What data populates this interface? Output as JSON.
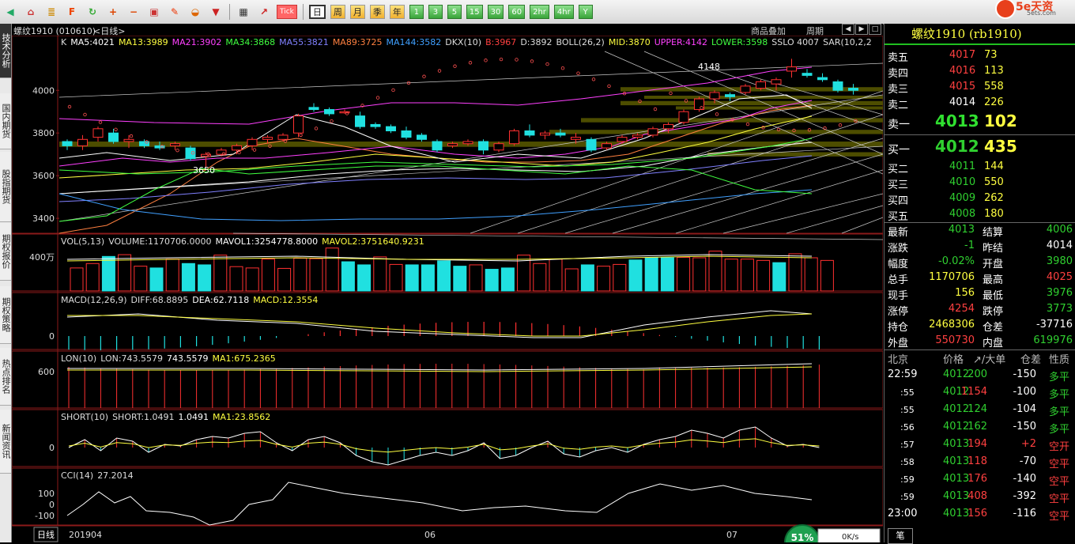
{
  "toolbar": {
    "icons": [
      "back-icon",
      "home-icon",
      "list-icon",
      "f10-icon",
      "refresh-icon",
      "zoom-in-icon",
      "zoom-out-icon",
      "window-icon",
      "pen-icon",
      "chart-icon",
      "filter-icon",
      "table-icon",
      "trend-icon"
    ],
    "tick_label": "Tick",
    "periods": [
      "日",
      "周",
      "月",
      "季",
      "年"
    ],
    "minutes": [
      "1",
      "3",
      "5",
      "15",
      "30",
      "60",
      "2hr",
      "4hr",
      "Y"
    ],
    "active_period": "日"
  },
  "sidebar": {
    "tabs": [
      "技术分析",
      "国内期货",
      "股指期货",
      "期权报价",
      "期权策略",
      "热点排名",
      "新闻资讯"
    ]
  },
  "chart": {
    "header_title": "螺纹1910 (010610)",
    "header_period": "<日线>",
    "top_right": [
      "商品叠加",
      "周期"
    ],
    "k_legend": [
      {
        "text": "K",
        "color": "#dddddd"
      },
      {
        "text": "MA5:4021",
        "color": "#ffffff"
      },
      {
        "text": "MA13:3989",
        "color": "#ffff40"
      },
      {
        "text": "MA21:3902",
        "color": "#ff40ff"
      },
      {
        "text": "MA34:3868",
        "color": "#40ff40"
      },
      {
        "text": "MA55:3821",
        "color": "#8080ff"
      },
      {
        "text": "MA89:3725",
        "color": "#ff8040"
      },
      {
        "text": "MA144:3582",
        "color": "#40a0ff"
      },
      {
        "text": "DKX(10)",
        "color": "#dddddd"
      },
      {
        "text": "B:3967",
        "color": "#ff4040"
      },
      {
        "text": "D:3892",
        "color": "#dddddd"
      },
      {
        "text": "BOLL(26,2)",
        "color": "#dddddd"
      },
      {
        "text": "MID:3870",
        "color": "#ffff40"
      },
      {
        "text": "UPPER:4142",
        "color": "#ff40ff"
      },
      {
        "text": "LOWER:3598",
        "color": "#40ff40"
      },
      {
        "text": "SSLO 4007",
        "color": "#dddddd"
      },
      {
        "text": "SAR(10,2,2",
        "color": "#dddddd"
      }
    ],
    "price_axis": [
      "4000",
      "3800",
      "3600",
      "3400"
    ],
    "high_mark": "4148",
    "low_mark": "3650",
    "vol_legend": {
      "a": "VOL(5,13)",
      "b": "VOLUME:1170706.0000",
      "c": "MAVOL1:3254778.8000",
      "d": "MAVOL2:3751640.9231"
    },
    "vol_axis": "400万",
    "macd_legend": {
      "a": "MACD(12,26,9)",
      "b": "DIFF:68.8895",
      "c": "DEA:62.7118",
      "d": "MACD:12.3554"
    },
    "macd_axis": "0",
    "lon_legend": {
      "a": "LON(10)",
      "b": "LON:743.5579",
      "c": "743.5579",
      "d": "MA1:675.2365"
    },
    "lon_axis": "600",
    "short_legend": {
      "a": "SHORT(10)",
      "b": "SHORT:1.0491",
      "c": "1.0491",
      "d": "MA1:23.8562"
    },
    "short_axis": "0",
    "cci_legend": {
      "a": "CCI(14)",
      "b": "27.2014"
    },
    "cci_axis": [
      "100",
      "0",
      "-100"
    ],
    "x_axis": [
      "201904",
      "06",
      "07"
    ],
    "bottom_tab": "日线",
    "percent_badge": "51%",
    "net_speed": "0K/s"
  },
  "quote": {
    "title": "螺纹1910 (rb1910)",
    "logo": "5e天资",
    "logo_url": "5ets.com",
    "sell": [
      {
        "label": "卖五",
        "price": "4017",
        "vol": "73"
      },
      {
        "label": "卖四",
        "price": "4016",
        "vol": "113"
      },
      {
        "label": "卖三",
        "price": "4015",
        "vol": "558"
      },
      {
        "label": "卖二",
        "price": "4014",
        "vol": "226"
      },
      {
        "label": "卖一",
        "price": "4013",
        "vol": "102"
      }
    ],
    "buy": [
      {
        "label": "买一",
        "price": "4012",
        "vol": "435"
      },
      {
        "label": "买二",
        "price": "4011",
        "vol": "144"
      },
      {
        "label": "买三",
        "price": "4010",
        "vol": "550"
      },
      {
        "label": "买四",
        "price": "4009",
        "vol": "262"
      },
      {
        "label": "买五",
        "price": "4008",
        "vol": "180"
      }
    ],
    "stats": [
      {
        "l1": "最新",
        "v1": "4013",
        "c1": "green",
        "l2": "结算",
        "v2": "4006",
        "c2": "green"
      },
      {
        "l1": "涨跌",
        "v1": "-1",
        "c1": "green",
        "l2": "昨结",
        "v2": "4014",
        "c2": "white"
      },
      {
        "l1": "幅度",
        "v1": "-0.02%",
        "c1": "green",
        "l2": "开盘",
        "v2": "3980",
        "c2": "green"
      },
      {
        "l1": "总手",
        "v1": "1170706",
        "c1": "yellow",
        "l2": "最高",
        "v2": "4025",
        "c2": "red"
      },
      {
        "l1": "现手",
        "v1": "156",
        "c1": "yellow",
        "l2": "最低",
        "v2": "3976",
        "c2": "green"
      },
      {
        "l1": "涨停",
        "v1": "4254",
        "c1": "red",
        "l2": "跌停",
        "v2": "3773",
        "c2": "green"
      },
      {
        "l1": "持仓",
        "v1": "2468306",
        "c1": "yellow",
        "l2": "仓差",
        "v2": "-37716",
        "c2": "white"
      },
      {
        "l1": "外盘",
        "v1": "550730",
        "c1": "red",
        "l2": "内盘",
        "v2": "619976",
        "c2": "green"
      }
    ],
    "ticks_header": {
      "time": "北京",
      "price": "价格",
      "vol": "↗/大单",
      "diff": "仓差",
      "nature": "性质"
    },
    "ticks": [
      {
        "time": "22:59",
        "price": "4012",
        "vol": "200",
        "diff": "-150",
        "nature": "多平"
      },
      {
        "time": ":55",
        "price": "4012",
        "vol": "1154",
        "diff": "-100",
        "nature": "多平"
      },
      {
        "time": ":55",
        "price": "4012",
        "vol": "124",
        "diff": "-104",
        "nature": "多平"
      },
      {
        "time": ":56",
        "price": "4012",
        "vol": "162",
        "diff": "-150",
        "nature": "多平"
      },
      {
        "time": ":57",
        "price": "4013",
        "vol": "194",
        "diff": "+2",
        "nature": "空开"
      },
      {
        "time": ":58",
        "price": "4013",
        "vol": "118",
        "diff": "-70",
        "nature": "空平"
      },
      {
        "time": ":59",
        "price": "4013",
        "vol": "176",
        "diff": "-140",
        "nature": "空平"
      },
      {
        "time": ":59",
        "price": "4013",
        "vol": "408",
        "diff": "-392",
        "nature": "空平"
      },
      {
        "time": "23:00",
        "price": "4013",
        "vol": "156",
        "diff": "-116",
        "nature": "空平"
      }
    ],
    "bottom_tab": "笔"
  },
  "chart_data": {
    "type": "candlestick",
    "title": "螺纹1910 (010610)",
    "ylim": [
      3330,
      4190
    ],
    "candles": [
      [
        3760,
        3770,
        3720,
        3740
      ],
      [
        3740,
        3790,
        3720,
        3770
      ],
      [
        3780,
        3830,
        3760,
        3820
      ],
      [
        3800,
        3820,
        3750,
        3760
      ],
      [
        3760,
        3790,
        3730,
        3770
      ],
      [
        3760,
        3770,
        3730,
        3740
      ],
      [
        3740,
        3760,
        3720,
        3730
      ],
      [
        3740,
        3760,
        3720,
        3750
      ],
      [
        3730,
        3740,
        3670,
        3680
      ],
      [
        3690,
        3710,
        3640,
        3700
      ],
      [
        3700,
        3730,
        3690,
        3720
      ],
      [
        3720,
        3750,
        3700,
        3740
      ],
      [
        3740,
        3780,
        3720,
        3770
      ],
      [
        3770,
        3790,
        3750,
        3780
      ],
      [
        3770,
        3800,
        3760,
        3790
      ],
      [
        3800,
        3890,
        3780,
        3880
      ],
      [
        3920,
        3940,
        3900,
        3910
      ],
      [
        3910,
        3920,
        3880,
        3890
      ],
      [
        3900,
        3910,
        3890,
        3900
      ],
      [
        3880,
        3900,
        3820,
        3830
      ],
      [
        3840,
        3850,
        3820,
        3830
      ],
      [
        3830,
        3840,
        3800,
        3810
      ],
      [
        3810,
        3830,
        3770,
        3780
      ],
      [
        3790,
        3800,
        3760,
        3770
      ],
      [
        3760,
        3770,
        3710,
        3720
      ],
      [
        3740,
        3760,
        3730,
        3750
      ],
      [
        3750,
        3770,
        3740,
        3760
      ],
      [
        3760,
        3770,
        3700,
        3720
      ],
      [
        3720,
        3760,
        3710,
        3750
      ],
      [
        3750,
        3820,
        3740,
        3810
      ],
      [
        3810,
        3840,
        3780,
        3790
      ],
      [
        3790,
        3810,
        3770,
        3800
      ],
      [
        3800,
        3820,
        3780,
        3790
      ],
      [
        3770,
        3800,
        3750,
        3780
      ],
      [
        3770,
        3780,
        3710,
        3720
      ],
      [
        3730,
        3760,
        3720,
        3750
      ],
      [
        3760,
        3790,
        3750,
        3780
      ],
      [
        3780,
        3800,
        3770,
        3790
      ],
      [
        3790,
        3830,
        3780,
        3820
      ],
      [
        3820,
        3850,
        3800,
        3840
      ],
      [
        3850,
        3910,
        3840,
        3900
      ],
      [
        3910,
        3970,
        3900,
        3960
      ],
      [
        3960,
        4000,
        3940,
        3990
      ],
      [
        3980,
        3990,
        3950,
        3970
      ],
      [
        3990,
        4030,
        3980,
        4020
      ],
      [
        4010,
        4050,
        4000,
        4040
      ],
      [
        4030,
        4060,
        4000,
        4050
      ],
      [
        4090,
        4148,
        4060,
        4110
      ],
      [
        4080,
        4100,
        4060,
        4070
      ],
      [
        4060,
        4080,
        4040,
        4050
      ],
      [
        4040,
        4050,
        3990,
        4000
      ],
      [
        4010,
        4030,
        3980,
        4000
      ]
    ],
    "volume": [
      52,
      62,
      78,
      82,
      56,
      52,
      72,
      62,
      59,
      81,
      55,
      52,
      72,
      51,
      74,
      73,
      97,
      66,
      59,
      77,
      60,
      59,
      59,
      68,
      56,
      59,
      49,
      52,
      81,
      62,
      72,
      50,
      59,
      56,
      60,
      70,
      75,
      75,
      76,
      75,
      90,
      72,
      72,
      69,
      64,
      84,
      75,
      69,
      76,
      74,
      73,
      53,
      65,
      72,
      20
    ],
    "volume_color": [
      "r",
      "r",
      "c",
      "r",
      "r",
      "c",
      "r",
      "c",
      "c",
      "r",
      "r",
      "r",
      "r",
      "r",
      "r",
      "r",
      "r",
      "c",
      "c",
      "r",
      "r",
      "c",
      "c",
      "c",
      "c",
      "r",
      "c",
      "c",
      "r",
      "r",
      "r",
      "r",
      "c",
      "r",
      "r",
      "c",
      "c",
      "c",
      "r",
      "r",
      "r",
      "r",
      "r",
      "r",
      "c",
      "r",
      "r",
      "r",
      "r",
      "c",
      "r",
      "c",
      "c",
      "c",
      "r",
      "r"
    ]
  }
}
